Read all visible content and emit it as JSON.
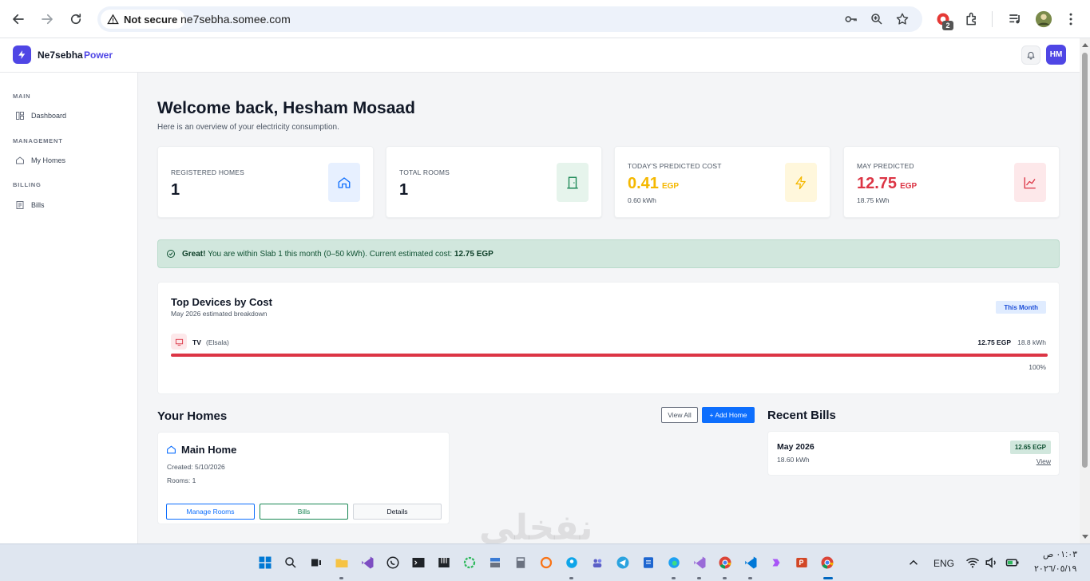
{
  "browser": {
    "security_label": "Not secure",
    "url": "ne7sebha.somee.com",
    "extension_badge": "2"
  },
  "header": {
    "brand_name": "Ne7sebha",
    "brand_accent": "Power",
    "avatar_initials": "HM",
    "brand_color": "#4f46e5"
  },
  "sidebar": {
    "sections": [
      {
        "label": "MAIN",
        "items": [
          {
            "label": "Dashboard",
            "icon": "dashboard-icon"
          }
        ]
      },
      {
        "label": "MANAGEMENT",
        "items": [
          {
            "label": "My Homes",
            "icon": "home-icon"
          }
        ]
      },
      {
        "label": "BILLING",
        "items": [
          {
            "label": "Bills",
            "icon": "bill-icon"
          }
        ]
      }
    ]
  },
  "main": {
    "title": "Welcome back, Hesham Mosaad",
    "subtitle": "Here is an overview of your electricity consumption.",
    "stats": [
      {
        "label": "REGISTERED HOMES",
        "value": "1",
        "icon": "home-icon",
        "color": "#0d6efd"
      },
      {
        "label": "TOTAL ROOMS",
        "value": "1",
        "icon": "door-icon",
        "color": "#198754"
      },
      {
        "label": "TODAY'S PREDICTED COST",
        "value": "0.41",
        "unit": "EGP",
        "sub": "0.60 kWh",
        "icon": "bolt-icon",
        "color": "#f5b800"
      },
      {
        "label": "MAY PREDICTED",
        "value": "12.75",
        "unit": "EGP",
        "sub": "18.75 kWh",
        "icon": "chart-icon",
        "color": "#dc3545"
      }
    ],
    "alert": {
      "strong": "Great!",
      "text": "You are within Slab 1 this month (0–50 kWh). Current estimated cost:",
      "cost": "12.75 EGP"
    },
    "devices": {
      "title": "Top Devices by Cost",
      "subtitle": "May 2026 estimated breakdown",
      "badge": "This Month",
      "items": [
        {
          "name": "TV",
          "room": "(Elsala)",
          "cost": "12.75 EGP",
          "kwh": "18.8 kWh",
          "percent_label": "100%",
          "share": 1.0
        }
      ]
    },
    "homes": {
      "title": "Your Homes",
      "view_all": "View All",
      "add_home": "+ Add Home",
      "items": [
        {
          "name": "Main Home",
          "created": "Created: 5/10/2026",
          "rooms": "Rooms: 1",
          "buttons": {
            "manage": "Manage Rooms",
            "bills": "Bills",
            "details": "Details"
          }
        }
      ]
    },
    "bills": {
      "title": "Recent Bills",
      "items": [
        {
          "month": "May 2026",
          "kwh": "18.60 kWh",
          "amount": "12.65 EGP",
          "view": "View"
        }
      ]
    }
  },
  "watermark": "نفخلي",
  "taskbar": {
    "language": "ENG",
    "time": "٠١:٠٣ ص",
    "date": "٢٠٢٦/٠٥/١٩"
  }
}
